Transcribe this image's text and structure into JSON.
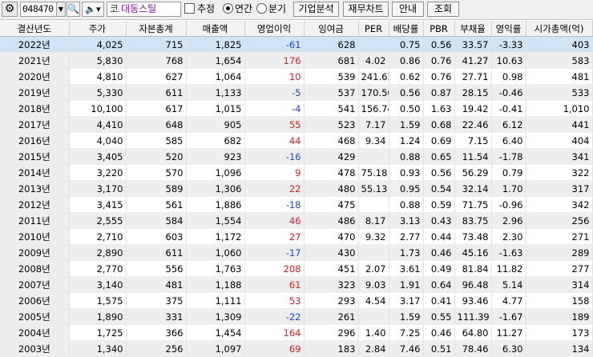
{
  "toolbar": {
    "gear_icon": "gear-icon",
    "stock_code": "048470",
    "market_prefix": "코",
    "stock_name": "대동스틸",
    "checkbox_label": "추정",
    "radio_annual": "연간",
    "radio_quarter": "분기",
    "buttons": [
      "기업분석",
      "재무차트",
      "안내",
      "조회"
    ]
  },
  "colors": {
    "negative": "#1f46d8",
    "positive_highlight": "#d62020",
    "selected_row": "#cfe5f6"
  },
  "table": {
    "headers": [
      "결산년도",
      "주가",
      "자본총계",
      "매출액",
      "영업이익",
      "잉여금",
      "PER",
      "배당률",
      "PBR",
      "부채율",
      "영익률",
      "시가총액(억)"
    ],
    "rows": [
      [
        "2022년",
        "4,025",
        "715",
        "1,825",
        "-61",
        "628",
        "",
        "0.75",
        "0.56",
        "33.57",
        "-3.33",
        "403"
      ],
      [
        "2021년",
        "5,830",
        "768",
        "1,654",
        "176",
        "681",
        "4.02",
        "0.86",
        "0.76",
        "41.27",
        "10.63",
        "583"
      ],
      [
        "2020년",
        "4,810",
        "627",
        "1,064",
        "10",
        "539",
        "241.63",
        "0.62",
        "0.76",
        "27.71",
        "0.98",
        "481"
      ],
      [
        "2019년",
        "5,330",
        "611",
        "1,133",
        "-5",
        "537",
        "170.50",
        "0.56",
        "0.87",
        "28.15",
        "-0.46",
        "533"
      ],
      [
        "2018년",
        "10,100",
        "617",
        "1,015",
        "-4",
        "541",
        "156.74",
        "0.50",
        "1.63",
        "19.42",
        "-0.41",
        "1,010"
      ],
      [
        "2017년",
        "4,410",
        "648",
        "905",
        "55",
        "523",
        "7.17",
        "1.59",
        "0.68",
        "22.46",
        "6.12",
        "441"
      ],
      [
        "2016년",
        "4,040",
        "585",
        "682",
        "44",
        "468",
        "9.34",
        "1.24",
        "0.69",
        "7.15",
        "6.40",
        "404"
      ],
      [
        "2015년",
        "3,405",
        "520",
        "923",
        "-16",
        "429",
        "",
        "0.88",
        "0.65",
        "11.54",
        "-1.78",
        "341"
      ],
      [
        "2014년",
        "3,220",
        "570",
        "1,096",
        "9",
        "478",
        "75.18",
        "0.93",
        "0.56",
        "56.29",
        "0.79",
        "322"
      ],
      [
        "2013년",
        "3,170",
        "589",
        "1,306",
        "22",
        "480",
        "55.13",
        "0.95",
        "0.54",
        "32.14",
        "1.70",
        "317"
      ],
      [
        "2012년",
        "3,415",
        "561",
        "1,886",
        "-18",
        "475",
        "",
        "0.88",
        "0.59",
        "71.75",
        "-0.96",
        "342"
      ],
      [
        "2011년",
        "2,555",
        "584",
        "1,554",
        "46",
        "486",
        "8.17",
        "3.13",
        "0.43",
        "83.75",
        "2.96",
        "256"
      ],
      [
        "2010년",
        "2,710",
        "603",
        "1,172",
        "27",
        "470",
        "9.32",
        "2.77",
        "0.44",
        "73.48",
        "2.30",
        "271"
      ],
      [
        "2009년",
        "2,890",
        "611",
        "1,060",
        "-17",
        "430",
        "",
        "1.73",
        "0.46",
        "45.16",
        "-1.63",
        "289"
      ],
      [
        "2008년",
        "2,770",
        "556",
        "1,763",
        "208",
        "451",
        "2.07",
        "3.61",
        "0.49",
        "81.84",
        "11.82",
        "277"
      ],
      [
        "2007년",
        "3,140",
        "481",
        "1,188",
        "61",
        "323",
        "9.03",
        "1.91",
        "0.64",
        "96.48",
        "5.14",
        "314"
      ],
      [
        "2006년",
        "1,575",
        "375",
        "1,111",
        "53",
        "293",
        "4.54",
        "3.17",
        "0.41",
        "93.46",
        "4.77",
        "158"
      ],
      [
        "2005년",
        "1,890",
        "331",
        "1,309",
        "-22",
        "261",
        "",
        "1.59",
        "0.55",
        "111.39",
        "-1.67",
        "189"
      ],
      [
        "2004년",
        "1,725",
        "366",
        "1,454",
        "164",
        "296",
        "1.40",
        "7.25",
        "0.46",
        "64.80",
        "11.27",
        "173"
      ],
      [
        "2003년",
        "1,340",
        "256",
        "1,097",
        "69",
        "183",
        "2.84",
        "7.46",
        "0.51",
        "78.46",
        "6.30",
        "134"
      ]
    ]
  }
}
